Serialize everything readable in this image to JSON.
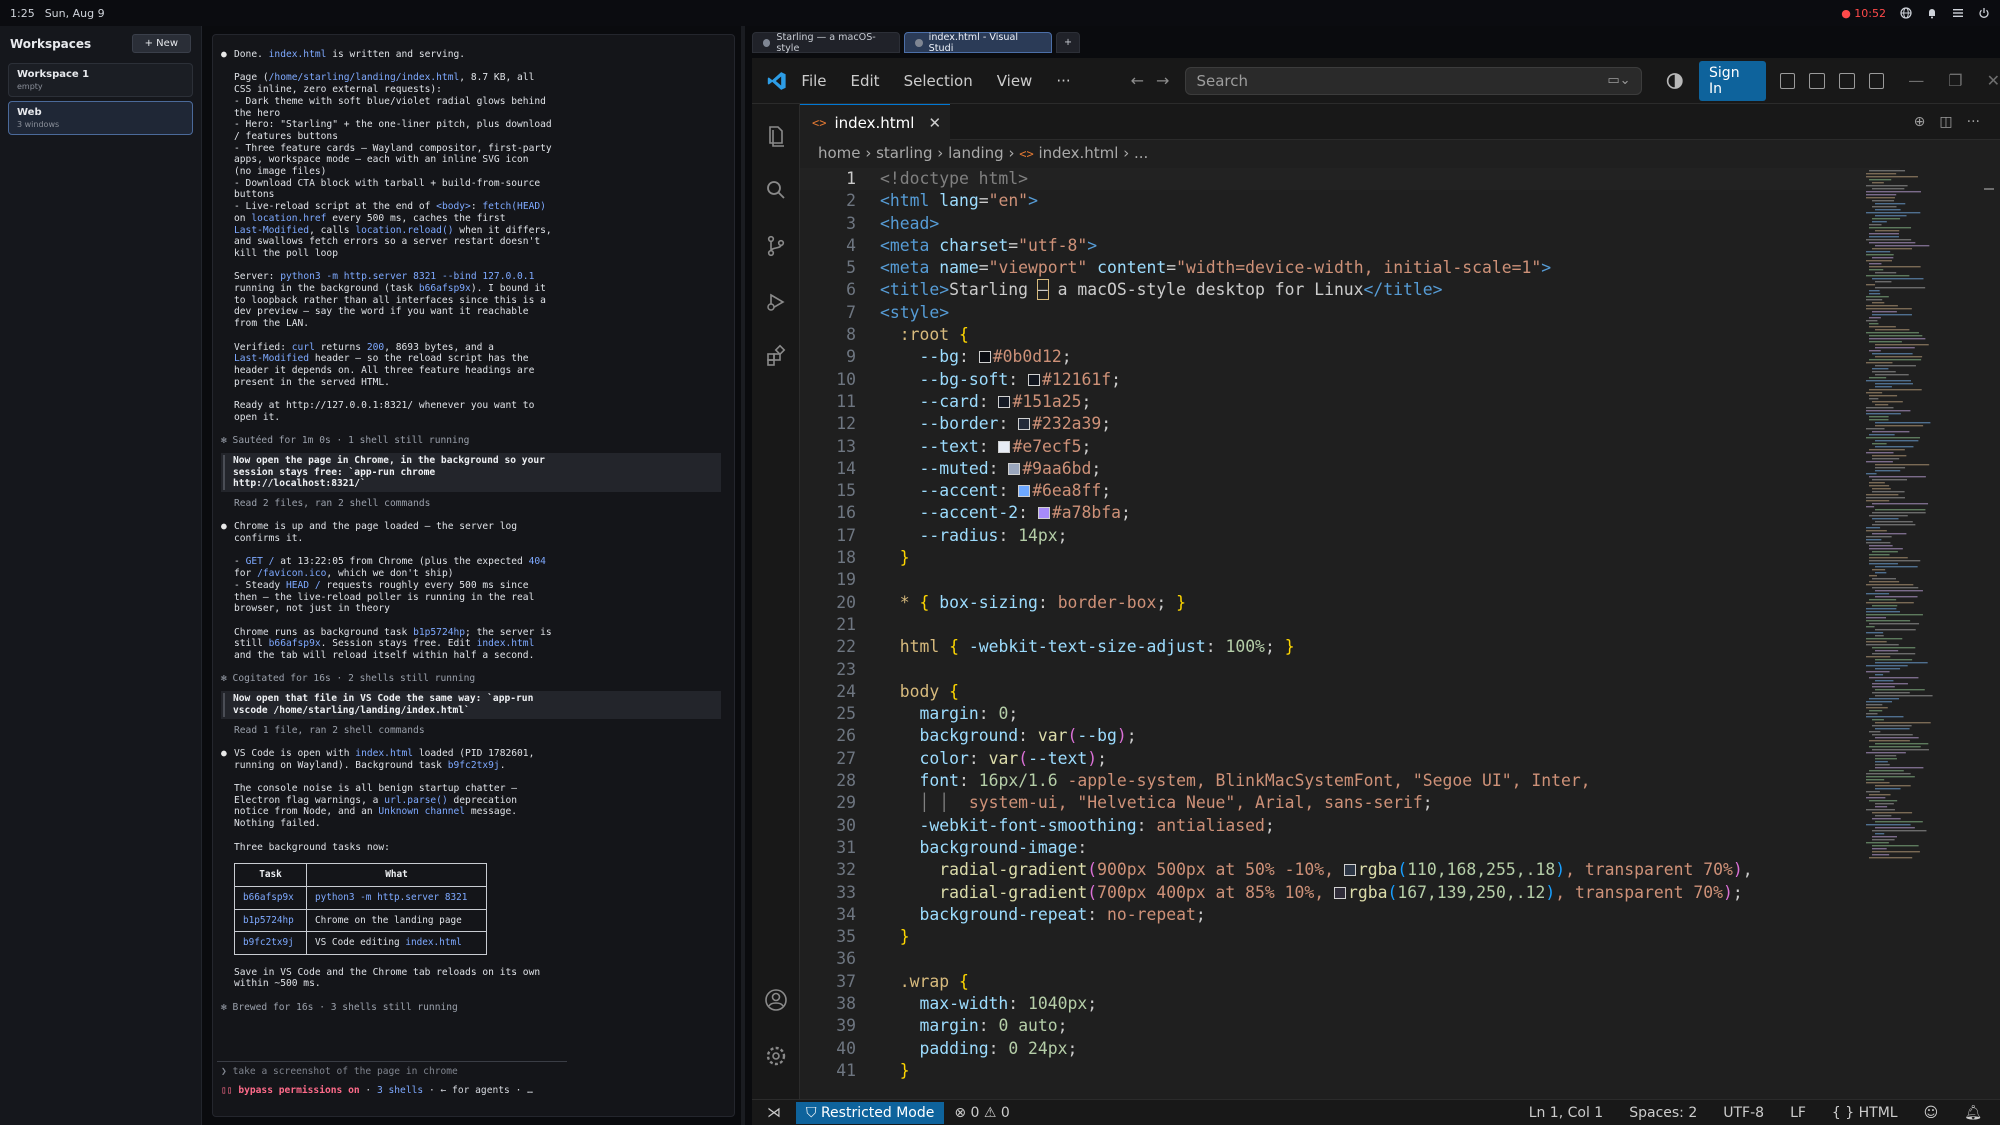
{
  "system": {
    "time": "1:25",
    "date": "Sun, Aug 9",
    "recording": "● 10:52"
  },
  "sidebar": {
    "title": "Workspaces",
    "new_label": "+ New",
    "workspaces": [
      {
        "name": "Workspace 1",
        "sub": "empty"
      },
      {
        "name": "Web",
        "sub": "3 windows"
      }
    ]
  },
  "terminal": {
    "b1_l1_pre": "Done. ",
    "b1_l1_code": "index.html",
    "b1_l1_post": " is written and serving.",
    "page_line1_pre": "Page (",
    "page_path": "/home/starling/landing/index.html",
    "page_line1_post": ", 8.7 KB, all",
    "page_body": "CSS inline, zero external requests):\n- Dark theme with soft blue/violet radial glows behind\nthe hero\n- Hero: \"Starling\" + the one-liner pitch, plus download\n/ features buttons\n- Three feature cards — Wayland compositor, first-party\napps, workspace mode — each with an inline SVG icon\n(no image files)\n- Download CTA block with tarball + build-from-source\nbuttons",
    "live_pre": "- Live-reload script at the end of ",
    "live_body": "<body>",
    "live_colon": ": ",
    "live_fetch": "fetch(HEAD)",
    "live_on": "on ",
    "live_href": "location.href",
    "live_mid": " every 500 ms, caches the first",
    "live_lm": "Last-Modified",
    "live_calls": ", calls ",
    "live_reload": "location.reload()",
    "live_tail": " when it differs,\nand swallows fetch errors so a server restart doesn't\nkill the poll loop",
    "server_pre": "Server: ",
    "server_cmd": "python3 -m http.server 8321 --bind 127.0.0.1",
    "server_body1": "running in the background (task ",
    "server_task": "b66afsp9x",
    "server_body2": "). I bound it\nto loopback rather than all interfaces since this is a\ndev preview — say the word if you want it reachable\nfrom the LAN.",
    "ver_pre": "Verified: ",
    "ver_curl": "curl",
    "ver_mid1": " returns ",
    "ver_200": "200",
    "ver_mid2": ", 8693 bytes, and a",
    "ver_lm": "Last-Modified",
    "ver_tail": " header — so the reload script has the\nheader it depends on. All three feature headings are\npresent in the served HTML.",
    "ready": "Ready at http://127.0.0.1:8321/ whenever you want to\nopen it.",
    "meta1": "✻ Sautéed for 1m 0s · 1 shell still running",
    "q1": "Now open the page in Chrome, in the background so your\nsession stays free: `app-run chrome\nhttp://localhost:8321/`",
    "sub1": "Read 2 files, ran 2 shell commands",
    "b2_l1": "Chrome is up and the page loaded — the server log\nconfirms it.",
    "b2_get_pre": "- ",
    "b2_get": "GET /",
    "b2_get_mid": " at 13:22:05 from Chrome (plus the expected ",
    "b2_404": "404",
    "b2_for": "for ",
    "b2_fav": "/favicon.ico",
    "b2_fav_post": ", which we don't ship)",
    "b2_steady_pre": "- Steady ",
    "b2_head": "HEAD /",
    "b2_steady_post": " requests roughly every 500 ms since\nthen — the live-reload poller is running in the real\nbrowser, not just in theory",
    "b2_chrome_pre": "Chrome runs as background task ",
    "b2_chrome_task": "b1p5724hp",
    "b2_chrome_mid": "; the server is\nstill ",
    "b2_srv_task": "b66afsp9x",
    "b2_chrome_mid2": ". Session stays free. Edit ",
    "b2_idx": "index.html",
    "b2_chrome_tail": "\nand the tab will reload itself within half a second.",
    "meta2": "✻ Cogitated for 16s · 2 shells still running",
    "q2": "Now open that file in VS Code the same way: `app-run\nvscode /home/starling/landing/index.html`",
    "sub2": "Read 1 file, ran 2 shell commands",
    "b3_pre": "VS Code is open with ",
    "b3_idx": "index.html",
    "b3_mid": " loaded (PID 1782601,\nrunning on Wayland). Background task ",
    "b3_task": "b9fc2tx9j",
    "b3_end": ".",
    "b3_noise_pre": "The console noise is all benign startup chatter —\nElectron flag warnings, a ",
    "b3_url": "url.parse()",
    "b3_noise_mid": " deprecation\nnotice from Node, and an ",
    "b3_unk": "Unknown channel",
    "b3_noise_tail": " message.\nNothing failed.",
    "b3_three": "Three background tasks now:",
    "table_headers": [
      "Task",
      "What"
    ],
    "table_rows": [
      {
        "task": "b66afsp9x",
        "what": "python3 -m http.server 8321"
      },
      {
        "task": "b1p5724hp",
        "what": "Chrome on the landing page"
      },
      {
        "task": "b9fc2tx9j",
        "what_pre": "VS Code editing ",
        "what_code": "index.html"
      }
    ],
    "save": "Save in VS Code and the Chrome tab reloads on its own\nwithin ~500 ms.",
    "meta3": "✻ Brewed for 16s · 3 shells still running",
    "prompt_caret": "❯",
    "prompt_text": "take a screenshot of the page in chrome",
    "status_perm": "▯▯ bypass permissions on",
    "status_sep1": " · ",
    "status_shells": "3 shells",
    "status_rest": " · ← for agents · …"
  },
  "browser_tabs": [
    {
      "label": "Starling — a macOS-style"
    },
    {
      "label": "index.html - Visual Studi"
    },
    {
      "label": "+"
    }
  ],
  "vscode": {
    "menus": [
      "File",
      "Edit",
      "Selection",
      "View",
      "···"
    ],
    "search_placeholder": "Search",
    "signin": "Sign In",
    "tab_label": "index.html",
    "breadcrumbs": [
      "home",
      "starling",
      "landing",
      "index.html",
      "..."
    ],
    "status": {
      "restricted": "Restricted Mode",
      "problems": "⊗ 0 ⚠ 0",
      "position": "Ln 1, Col 1",
      "spaces": "Spaces: 2",
      "encoding": "UTF-8",
      "eol": "LF",
      "language": "{ } HTML"
    },
    "code_lines": [
      "1",
      "2",
      "3",
      "4",
      "5",
      "6",
      "7",
      "8",
      "9",
      "10",
      "11",
      "12",
      "13",
      "14",
      "15",
      "16",
      "17",
      "18",
      "19",
      "20",
      "21",
      "22",
      "23",
      "24",
      "25",
      "26",
      "27",
      "28",
      "29",
      "30",
      "31",
      "32",
      "33",
      "34",
      "35",
      "36",
      "37",
      "38",
      "39",
      "40",
      "41"
    ],
    "code": {
      "l1": "<!doctype html>",
      "l2_tag": "<html",
      "l2_attr": "lang",
      "l2_val": "\"en\"",
      "l3": "<head>",
      "l4_tag": "<meta",
      "l4_attr": "charset",
      "l4_val": "\"utf-8\"",
      "l5_tag": "<meta",
      "l5_attr1": "name",
      "l5_val1": "\"viewport\"",
      "l5_attr2": "content",
      "l5_val2": "\"width=device-width, initial-scale=1\"",
      "l6_open": "<title>",
      "l6_text1": "Starling ",
      "l6_dash": "—",
      "l6_text2": " a macOS-style desktop for Linux",
      "l6_close": "</title>",
      "l7": "<style>",
      "l8_sel": ":root",
      "l9_p": "--bg",
      "l9_v": "#0b0d12",
      "l10_p": "--bg-soft",
      "l10_v": "#12161f",
      "l11_p": "--card",
      "l11_v": "#151a25",
      "l12_p": "--border",
      "l12_v": "#232a39",
      "l13_p": "--text",
      "l13_v": "#e7ecf5",
      "l14_p": "--muted",
      "l14_v": "#9aa6bd",
      "l15_p": "--accent",
      "l15_v": "#6ea8ff",
      "l16_p": "--accent-2",
      "l16_v": "#a78bfa",
      "l17_p": "--radius",
      "l17_v": "14px",
      "l20_sel": "*",
      "l20_p": "box-sizing",
      "l20_v": "border-box",
      "l22_sel": "html",
      "l22_p": "-webkit-text-size-adjust",
      "l22_v": "100%",
      "l24_sel": "body",
      "l25_p": "margin",
      "l25_v": "0",
      "l26_p": "background",
      "l26_fn": "var",
      "l26_a": "--bg",
      "l27_p": "color",
      "l27_fn": "var",
      "l27_a": "--text",
      "l28_p": "font",
      "l28_v1": "16px/1.6",
      "l28_v2": " -apple-system, BlinkMacSystemFont, ",
      "l28_s1": "\"Segoe UI\"",
      "l28_v3": ", Inter,",
      "l29_v1": "system-ui, ",
      "l29_s1": "\"Helvetica Neue\"",
      "l29_v2": ", Arial, ",
      "l29_v3": "sans-serif",
      "l30_p": "-webkit-font-smoothing",
      "l30_v": "antialiased",
      "l31_p": "background-image",
      "l32_fn": "radial-gradient",
      "l32_v1": "900px 500px at 50% -10%, ",
      "l32_rgba": "rgba",
      "l32_a": "110,168,255,.18",
      "l32_t": ", transparent 70%",
      "l33_fn": "radial-gradient",
      "l33_v1": "700px 400px at 85% 10%, ",
      "l33_rgba": "rgba",
      "l33_a": "167,139,250,.12",
      "l33_t": ", transparent 70%",
      "l34_p": "background-repeat",
      "l34_v": "no-repeat",
      "l37_sel": ".wrap",
      "l38_p": "max-width",
      "l38_v": "1040px",
      "l39_p": "margin",
      "l39_v": "0 auto",
      "l40_p": "padding",
      "l40_v": "0 24px"
    }
  },
  "colors": {
    "accent": "#0e639c",
    "active_tab_border": "#0078d4",
    "terminal_code": "#7ea9ff",
    "permission_warning": "#ff6b8a"
  }
}
